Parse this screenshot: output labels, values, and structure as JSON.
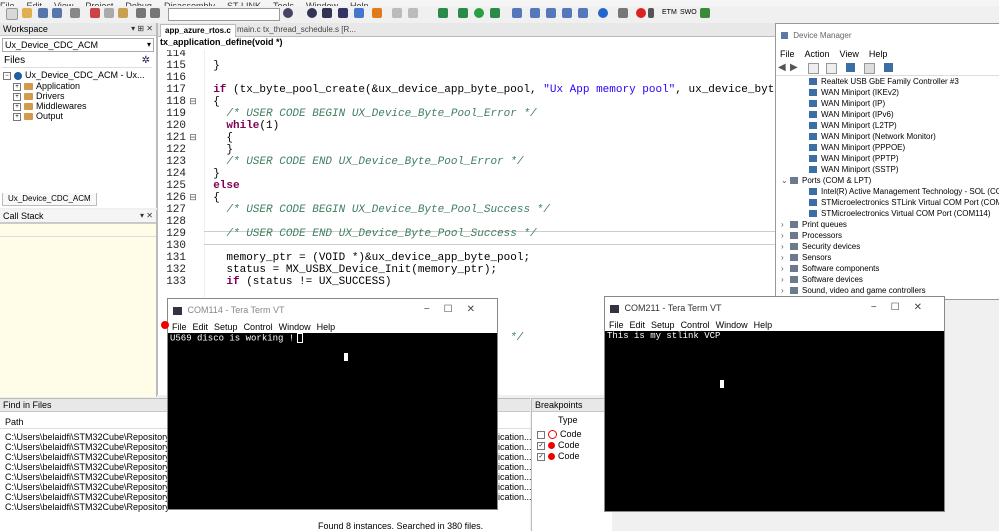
{
  "menu": [
    "File",
    "Edit",
    "View",
    "Project",
    "Debug",
    "Disassembly",
    "ST-LINK",
    "Tools",
    "Window",
    "Help"
  ],
  "colors": {
    "accent": "#1e5fbf",
    "term_bg": "#000000",
    "term_fg": "#ffffff",
    "tab_active": "#ffffff",
    "breakpoint": "#e00000",
    "comment": "#3f7f5f",
    "string": "#2a00ff"
  },
  "workspace": {
    "title": "Workspace",
    "project_select": "Ux_Device_CDC_ACM",
    "files_label": "Files",
    "tree": [
      {
        "label": "Ux_Device_CDC_ACM - Ux...",
        "icon": "project-icon"
      },
      {
        "label": "Application",
        "icon": "folder-icon"
      },
      {
        "label": "Drivers",
        "icon": "folder-icon"
      },
      {
        "label": "Middlewares",
        "icon": "folder-icon"
      },
      {
        "label": "Output",
        "icon": "folder-icon"
      }
    ],
    "bottom_tab": "Ux_Device_CDC_ACM"
  },
  "call_stack": {
    "title": "Call Stack"
  },
  "editor": {
    "tabs": [
      {
        "label": "app_azure_rtos.c",
        "active": true
      },
      {
        "label": "main.c",
        "active": false
      },
      {
        "label": "tx_thread_schedule.s [R...",
        "active": false
      }
    ],
    "function_bar": "tx_application_define(void *)",
    "lines": [
      {
        "n": "114",
        "fold": "",
        "text": ""
      },
      {
        "n": "115",
        "fold": "",
        "text": "  }"
      },
      {
        "n": "116",
        "fold": "",
        "text": ""
      },
      {
        "n": "117",
        "fold": "",
        "text": "  if (tx_byte_pool_create(&ux_device_app_byte_pool, \"Ux App memory pool\", ux_device_byte_pool_buffer, U"
      },
      {
        "n": "118",
        "fold": "⊟",
        "text": "  {"
      },
      {
        "n": "119",
        "fold": "",
        "text": "    /* USER CODE BEGIN UX_Device_Byte_Pool_Error */"
      },
      {
        "n": "120",
        "fold": "",
        "text": "    while(1)"
      },
      {
        "n": "121",
        "fold": "⊟",
        "text": "    {"
      },
      {
        "n": "122",
        "fold": "",
        "text": "    }"
      },
      {
        "n": "123",
        "fold": "",
        "text": "    /* USER CODE END UX_Device_Byte_Pool_Error */"
      },
      {
        "n": "124",
        "fold": "",
        "text": "  }"
      },
      {
        "n": "125",
        "fold": "",
        "text": "  else"
      },
      {
        "n": "126",
        "fold": "⊟",
        "text": "  {"
      },
      {
        "n": "127",
        "fold": "",
        "text": "    /* USER CODE BEGIN UX_Device_Byte_Pool_Success */"
      },
      {
        "n": "128",
        "fold": "",
        "text": ""
      },
      {
        "n": "129",
        "fold": "",
        "text": "    /* USER CODE END UX_Device_Byte_Pool_Success */"
      },
      {
        "n": "130",
        "fold": "",
        "text": ""
      },
      {
        "n": "131",
        "fold": "",
        "text": "    memory_ptr = (VOID *)&ux_device_app_byte_pool;"
      },
      {
        "n": "132",
        "fold": "",
        "text": "    status = MX_USBX_Device_Init(memory_ptr);"
      },
      {
        "n": "133",
        "fold": "",
        "text": "    if (status != UX_SUCCESS)"
      }
    ],
    "partial_comment": "*/"
  },
  "find_in_files": {
    "title": "Find in Files",
    "header": "Path",
    "rows": [
      "C:\\Users\\belaidfi\\STM32Cube\\Repository\\STM",
      "C:\\Users\\belaidfi\\STM32Cube\\Repository\\STM",
      "C:\\Users\\belaidfi\\STM32Cube\\Repository\\STM",
      "C:\\Users\\belaidfi\\STM32Cube\\Repository\\STM",
      "C:\\Users\\belaidfi\\STM32Cube\\Repository\\STM",
      "C:\\Users\\belaidfi\\STM32Cube\\Repository\\STM",
      "C:\\Users\\belaidfi\\STM32Cube\\Repository\\STM",
      "C:\\Users\\belaidfi\\STM32Cube\\Repository\\STM"
    ],
    "right_fragments": [
      "ication...",
      "ication...",
      "ication...",
      "ication...",
      "ication...",
      "ication...",
      "ication..."
    ],
    "footer": "Found 8 instances. Searched in 380 files."
  },
  "breakpoints": {
    "title": "Breakpoints",
    "header": "Type",
    "rows": [
      {
        "label": "Code",
        "checked": false,
        "enabled": false
      },
      {
        "label": "Code",
        "checked": true,
        "enabled": true
      },
      {
        "label": "Code",
        "checked": true,
        "enabled": true
      }
    ]
  },
  "device_manager": {
    "title": "Device Manager",
    "menu": [
      "File",
      "Action",
      "View",
      "Help"
    ],
    "items": [
      {
        "label": "Realtek USB GbE Family Controller #3",
        "level": 2,
        "icon": "network-adapter-icon"
      },
      {
        "label": "WAN Miniport (IKEv2)",
        "level": 2,
        "icon": "network-adapter-icon"
      },
      {
        "label": "WAN Miniport (IP)",
        "level": 2,
        "icon": "network-adapter-icon"
      },
      {
        "label": "WAN Miniport (IPv6)",
        "level": 2,
        "icon": "network-adapter-icon"
      },
      {
        "label": "WAN Miniport (L2TP)",
        "level": 2,
        "icon": "network-adapter-icon"
      },
      {
        "label": "WAN Miniport (Network Monitor)",
        "level": 2,
        "icon": "network-adapter-icon"
      },
      {
        "label": "WAN Miniport (PPPOE)",
        "level": 2,
        "icon": "network-adapter-icon"
      },
      {
        "label": "WAN Miniport (PPTP)",
        "level": 2,
        "icon": "network-adapter-icon"
      },
      {
        "label": "WAN Miniport (SSTP)",
        "level": 2,
        "icon": "network-adapter-icon"
      },
      {
        "label": "Ports (COM & LPT)",
        "level": 1,
        "icon": "port-icon",
        "expanded": true
      },
      {
        "label": "Intel(R) Active Management Technology - SOL (COM3)",
        "level": 2,
        "icon": "port-icon"
      },
      {
        "label": "STMicroelectronics STLink Virtual COM Port (COM211)",
        "level": 2,
        "icon": "port-icon"
      },
      {
        "label": "STMicroelectronics Virtual COM Port (COM114)",
        "level": 2,
        "icon": "port-icon"
      },
      {
        "label": "Print queues",
        "level": 1,
        "icon": "printer-icon"
      },
      {
        "label": "Processors",
        "level": 1,
        "icon": "processor-icon"
      },
      {
        "label": "Security devices",
        "level": 1,
        "icon": "security-icon"
      },
      {
        "label": "Sensors",
        "level": 1,
        "icon": "sensor-icon"
      },
      {
        "label": "Software components",
        "level": 1,
        "icon": "software-icon"
      },
      {
        "label": "Software devices",
        "level": 1,
        "icon": "software-icon"
      },
      {
        "label": "Sound, video and game controllers",
        "level": 1,
        "icon": "sound-icon"
      }
    ]
  },
  "com114": {
    "title": "COM114 - Tera Term VT",
    "menu": [
      "File",
      "Edit",
      "Setup",
      "Control",
      "Window",
      "Help"
    ],
    "text": "U569 disco is working !"
  },
  "com211": {
    "title": "COM211 - Tera Term VT",
    "menu": [
      "File",
      "Edit",
      "Setup",
      "Control",
      "Window",
      "Help"
    ],
    "text": "This is my stlink VCP"
  }
}
